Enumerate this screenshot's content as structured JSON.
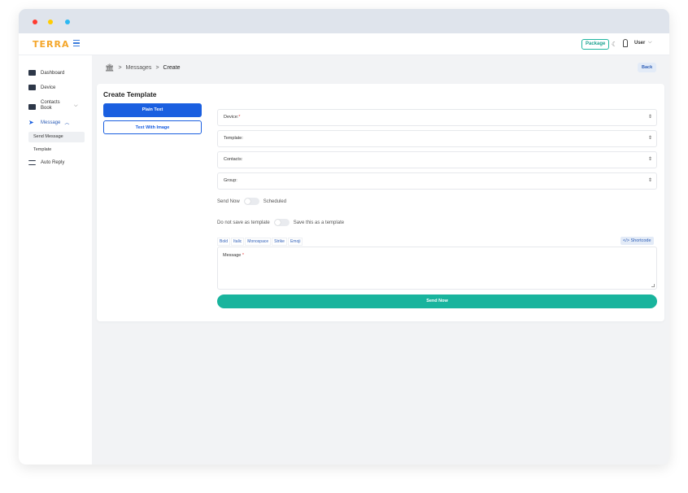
{
  "app": {
    "logo": "TERRA",
    "package_label": "Package",
    "user_label": "User"
  },
  "colors": {
    "accent": "#1a5fe0",
    "teal": "#19b49d",
    "logo": "#f4a62a"
  },
  "sidebar": {
    "items": [
      {
        "label": "Dashboard",
        "icon": "dashboard-icon"
      },
      {
        "label": "Device",
        "icon": "device-icon"
      },
      {
        "label": "Contacts Book",
        "icon": "contacts-icon"
      },
      {
        "label": "Message",
        "icon": "send-icon"
      },
      {
        "label": "Auto Reply",
        "icon": "auto-reply-icon"
      }
    ],
    "sub_items": [
      {
        "label": "Send Message",
        "active": true
      },
      {
        "label": "Template",
        "active": false
      }
    ]
  },
  "breadcrumb": {
    "home_icon": "bank-icon",
    "level1": "Messages",
    "level2": "Create"
  },
  "back_label": "Back",
  "card": {
    "title": "Create Template",
    "tab_plain": "Plain Text",
    "tab_image": "Text With Image",
    "fields": [
      {
        "label": "Device:",
        "required": true
      },
      {
        "label": "Template:",
        "required": false
      },
      {
        "label": "Contacts:",
        "required": false
      },
      {
        "label": "Group:",
        "required": false
      }
    ],
    "toggle1": {
      "left": "Send Now",
      "right": "Scheduled"
    },
    "toggle2": {
      "left": "Do not save as template",
      "right": "Save this as a template"
    },
    "format_buttons": [
      "Bold",
      "Italic",
      "Monospace",
      "Strike",
      "Emoji"
    ],
    "shortcode_label": "</> Shortcode",
    "message_label": "Message",
    "send_label": "Send Now"
  }
}
